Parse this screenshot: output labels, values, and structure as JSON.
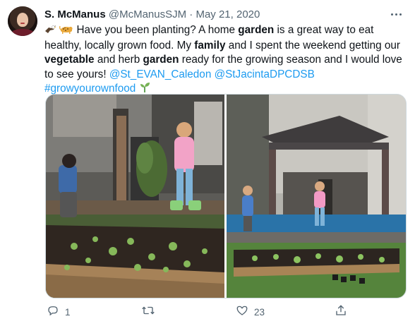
{
  "tweet": {
    "author_name": "S. McManus",
    "handle": "@McManusSJM",
    "separator": "·",
    "date": "May 21, 2020",
    "text": {
      "t1": "Have you been planting? A home ",
      "b1": "garden",
      "t2": " is a great way to eat healthy, locally grown food. My ",
      "b2": "family",
      "t3": " and I spent the weekend getting our ",
      "b3": "vegetable",
      "t4": " and herb ",
      "b4": "garden",
      "t5": " ready for the growing season and I would love to see yours! ",
      "mention1": "@St_EVAN_Caledon",
      "mention2": "@StJacintaDPCDSB",
      "hashtag": "#growyourownfood"
    },
    "icons": {
      "leading_emoji_1": "eagle-icon",
      "leading_emoji_2": "leopard-icon",
      "trailing_emoji": "seedling-icon",
      "more": "more-icon",
      "reply": "reply-icon",
      "retweet": "retweet-icon",
      "like": "like-icon",
      "share": "share-icon"
    },
    "media": [
      {
        "id": "photo-left",
        "description_hidden": ""
      },
      {
        "id": "photo-right",
        "description_hidden": ""
      }
    ],
    "actions": {
      "reply_count": "1",
      "retweet_count": "",
      "like_count": "23"
    },
    "colors": {
      "link": "#1d9bf0",
      "text": "#0f1419",
      "secondary": "#536471",
      "border": "#cfd9de"
    }
  }
}
